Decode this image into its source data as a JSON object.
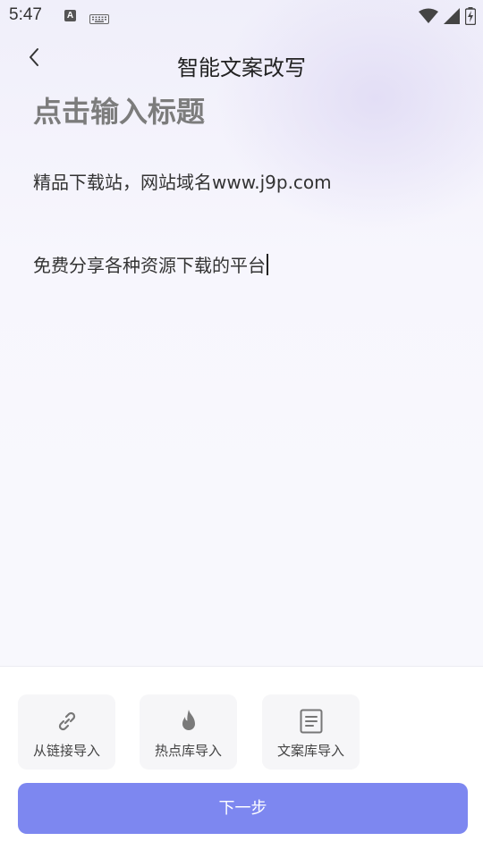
{
  "status_bar": {
    "time": "5:47",
    "a_icon_label": "A"
  },
  "header": {
    "title": "智能文案改写"
  },
  "editor": {
    "title_placeholder": "点击输入标题",
    "line1": "精品下载站，网站域名www.j9p.com",
    "line2": "免费分享各种资源下载的平台"
  },
  "import_buttons": [
    {
      "label": "从链接导入",
      "icon": "link-icon"
    },
    {
      "label": "热点库导入",
      "icon": "flame-icon"
    },
    {
      "label": "文案库导入",
      "icon": "document-icon"
    }
  ],
  "next_button": {
    "label": "下一步"
  },
  "colors": {
    "primary": "#7d87f0",
    "title_placeholder": "#7c7c7c",
    "text": "#333333"
  }
}
